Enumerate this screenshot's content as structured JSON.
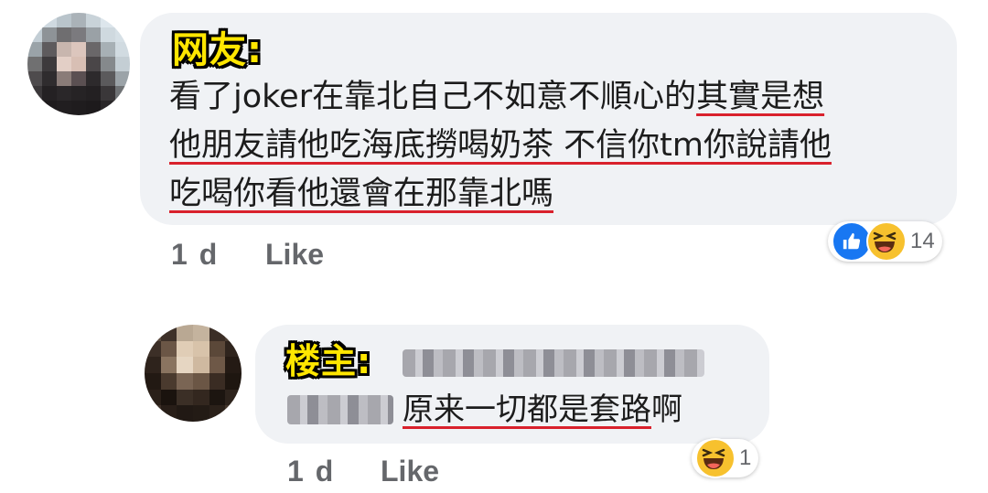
{
  "comment1": {
    "tag": "网友:",
    "lines": [
      {
        "plain": "看了joker在靠北自己不如意不順心的",
        "underlined": "其實是想"
      },
      {
        "plain": "",
        "underlined": "他朋友請他吃海底撈喝奶茶 不信你tm你說請他"
      },
      {
        "plain": "",
        "underlined": "吃喝你看他還會在那靠北嗎"
      }
    ],
    "time": "1 d",
    "like_label": "Like",
    "reaction_count": "14",
    "reactions": [
      "like-icon",
      "haha-icon"
    ]
  },
  "reply": {
    "tag": "楼主:",
    "text": "原来一切都是套路",
    "text_tail": "啊",
    "time": "1 d",
    "like_label": "Like",
    "reaction_count": "1",
    "reactions": [
      "haha-icon"
    ]
  },
  "colors": {
    "bubble": "#f0f2f5",
    "tag_fill": "#ffe600",
    "underline": "#d9212c",
    "meta": "#65676b",
    "like_blue": "#1877f2",
    "haha_yellow": "#f7c12e"
  }
}
